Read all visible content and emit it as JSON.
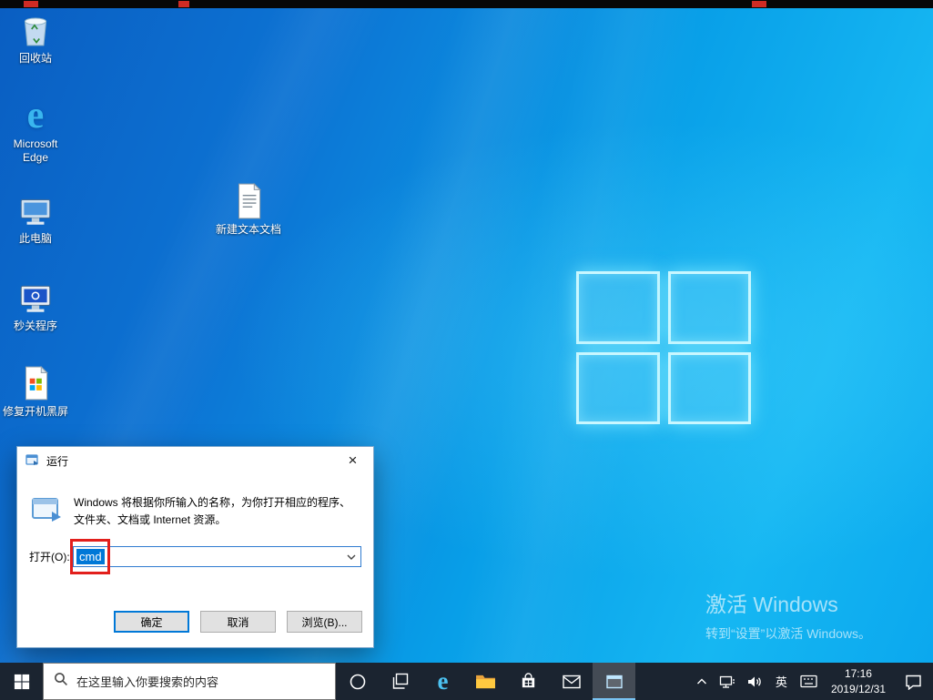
{
  "desktop": {
    "icons": [
      {
        "label": "回收站"
      },
      {
        "label": "Microsoft Edge"
      },
      {
        "label": "此电脑"
      },
      {
        "label": "秒关程序"
      },
      {
        "label": "修复开机黑屏"
      }
    ],
    "file_icon_label": "新建文本文档",
    "watermark_line1": "激活 Windows",
    "watermark_line2": "转到“设置”以激活 Windows。"
  },
  "run_dialog": {
    "title": "运行",
    "close": "×",
    "description": "Windows 将根据你所输入的名称，为你打开相应的程序、文件夹、文档或 Internet 资源。",
    "open_label": "打开(O):",
    "input_value": "cmd",
    "ok_label": "确定",
    "cancel_label": "取消",
    "browse_label": "浏览(B)..."
  },
  "taskbar": {
    "search_placeholder": "在这里输入你要搜索的内容",
    "ime_label": "英",
    "time": "17:16",
    "date": "2019/12/31"
  },
  "colors": {
    "accent": "#0078d7",
    "selection": "#0078d7",
    "annotation_red": "#e21f1c",
    "taskbar_bg": "#1b2430",
    "wallpaper_blue": "#089fe8"
  }
}
